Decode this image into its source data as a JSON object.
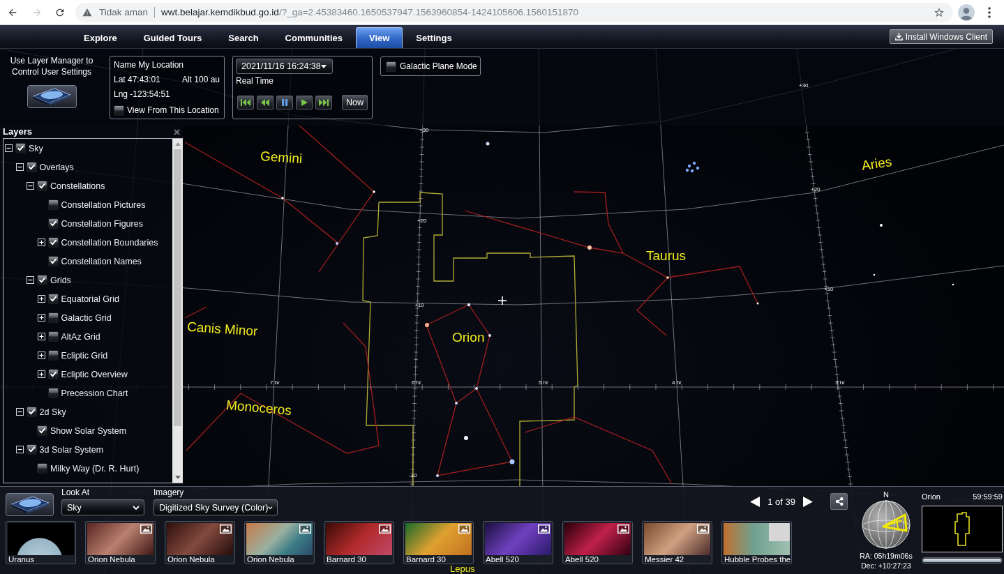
{
  "browser": {
    "back": {
      "disabled": false
    },
    "forward": {
      "disabled": true
    },
    "address": {
      "security": "Tidak aman",
      "host": "wwt.belajar.kemdikbud.go.id",
      "path": "/?_ga=2.45383460.1650537947.1563960854-1424105606.1560151870"
    }
  },
  "menu": {
    "tabs": [
      {
        "label": "Explore",
        "selected": false
      },
      {
        "label": "Guided Tours",
        "selected": false
      },
      {
        "label": "Search",
        "selected": false
      },
      {
        "label": "Communities",
        "selected": false
      },
      {
        "label": "View",
        "selected": true
      },
      {
        "label": "Settings",
        "selected": false
      }
    ],
    "install_button": "Install Windows Client"
  },
  "controls": {
    "layer_hint": "Use Layer Manager to Control User Settings",
    "location": {
      "name": "Name My Location",
      "lat": "Lat 47:43:01",
      "alt": "Alt 100 au",
      "lng": "Lng -123:54:51",
      "view_from": {
        "label": "View From This Location",
        "checked": false
      }
    },
    "time": {
      "datetime": "2021/11/16 16:24:38",
      "mode": "Real Time",
      "playback": [
        {
          "kind": "skip-back"
        },
        {
          "kind": "rewind"
        },
        {
          "kind": "pause"
        },
        {
          "kind": "play"
        },
        {
          "kind": "skip-forward"
        }
      ],
      "now_button": "Now"
    },
    "galactic_plane_mode": {
      "label": "Galactic Plane Mode",
      "checked": false
    }
  },
  "layers": {
    "title": "Layers",
    "items": [
      {
        "label": "Sky",
        "checked": true,
        "kind": "group",
        "expanded": true,
        "children": [
          {
            "label": "Overlays",
            "checked": true,
            "kind": "group",
            "expanded": true,
            "children": [
              {
                "label": "Constellations",
                "checked": true,
                "kind": "group",
                "expanded": true,
                "children": [
                  {
                    "label": "Constellation Pictures",
                    "checked": false,
                    "kind": "leaf"
                  },
                  {
                    "label": "Constellation Figures",
                    "checked": true,
                    "kind": "leaf"
                  },
                  {
                    "label": "Constellation Boundaries",
                    "checked": true,
                    "kind": "group",
                    "expanded": false
                  },
                  {
                    "label": "Constellation Names",
                    "checked": true,
                    "kind": "leaf"
                  }
                ]
              },
              {
                "label": "Grids",
                "checked": true,
                "kind": "group",
                "expanded": true,
                "children": [
                  {
                    "label": "Equatorial Grid",
                    "checked": true,
                    "kind": "group",
                    "expanded": false
                  },
                  {
                    "label": "Galactic Grid",
                    "checked": false,
                    "kind": "group",
                    "expanded": false
                  },
                  {
                    "label": "AltAz Grid",
                    "checked": false,
                    "kind": "group",
                    "expanded": false
                  },
                  {
                    "label": "Ecliptic Grid",
                    "checked": false,
                    "kind": "group",
                    "expanded": false
                  },
                  {
                    "label": "Ecliptic Overview",
                    "checked": true,
                    "kind": "group",
                    "expanded": false
                  },
                  {
                    "label": "Precession Chart",
                    "checked": false,
                    "kind": "leaf"
                  }
                ]
              }
            ]
          },
          {
            "label": "2d Sky",
            "checked": true,
            "kind": "group",
            "expanded": true,
            "children": [
              {
                "label": "Show Solar System",
                "checked": true,
                "kind": "leaf"
              }
            ]
          },
          {
            "label": "3d Solar System",
            "checked": true,
            "kind": "group",
            "expanded": true,
            "children": [
              {
                "label": "Milky Way (Dr. R. Hurt)",
                "checked": false,
                "kind": "leaf"
              }
            ]
          }
        ]
      }
    ]
  },
  "sky": {
    "constellation_labels": [
      "Gemini",
      "Aries",
      "Taurus",
      "Canis Minor",
      "Orion",
      "Monoceros",
      "Lepus"
    ],
    "grid_labels": [
      "+30",
      "+20",
      "+10",
      "-10",
      "7 hr",
      "6 hr",
      "5 hr",
      "4 hr",
      "3 hr",
      "+20",
      "+10",
      "+30"
    ]
  },
  "bottom": {
    "look_at": {
      "label": "Look At",
      "value": "Sky"
    },
    "imagery": {
      "label": "Imagery",
      "value": "Digitized Sky Survey (Color)"
    },
    "pager": "1 of 39",
    "thumbnails": [
      {
        "caption": "Uranus",
        "image_icon": false
      },
      {
        "caption": "Orion Nebula",
        "image_icon": true
      },
      {
        "caption": "Orion Nebula",
        "image_icon": true
      },
      {
        "caption": "Orion Nebula",
        "image_icon": true
      },
      {
        "caption": "Barnard 30",
        "image_icon": true
      },
      {
        "caption": "Barnard 30",
        "image_icon": true
      },
      {
        "caption": "Abell 520",
        "image_icon": true
      },
      {
        "caption": "Abell 520",
        "image_icon": true
      },
      {
        "caption": "Messier 42",
        "image_icon": true
      },
      {
        "caption": "Hubble Probes the",
        "image_icon": false
      }
    ],
    "compass": {
      "north": "N",
      "ra": "RA: 05h19m06s",
      "dec": "Dec: +10:27:23"
    },
    "minimap": {
      "title": "Orion",
      "time": "59:59:59",
      "level": 1
    }
  }
}
